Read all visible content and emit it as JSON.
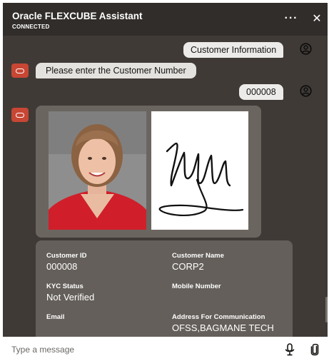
{
  "header": {
    "title": "Oracle FLEXCUBE Assistant",
    "status": "CONNECTED",
    "more_icon": "more-icon",
    "close_icon": "close-icon"
  },
  "messages": [
    {
      "from": "user",
      "text": "Customer Information"
    },
    {
      "from": "bot",
      "text": "Please enter the Customer Number"
    },
    {
      "from": "user",
      "text": "000008"
    }
  ],
  "customer": {
    "fields": [
      {
        "label": "Customer ID",
        "value": "000008"
      },
      {
        "label": "Customer Name",
        "value": "CORP2"
      },
      {
        "label": "KYC Status",
        "value": "Not Verified"
      },
      {
        "label": "Mobile Number",
        "value": ""
      },
      {
        "label": "Email",
        "value": ""
      },
      {
        "label": "Address For Communication",
        "value": "OFSS,BAGMANE TECH"
      }
    ]
  },
  "composer": {
    "placeholder": "Type a message",
    "mic_icon": "microphone-icon",
    "attach_icon": "paperclip-icon"
  },
  "colors": {
    "header_bg": "#312d2a",
    "chat_bg": "#3f3a36",
    "brand_red": "#c74634",
    "bubble": "#ecebe9",
    "card": "#645f5a"
  }
}
